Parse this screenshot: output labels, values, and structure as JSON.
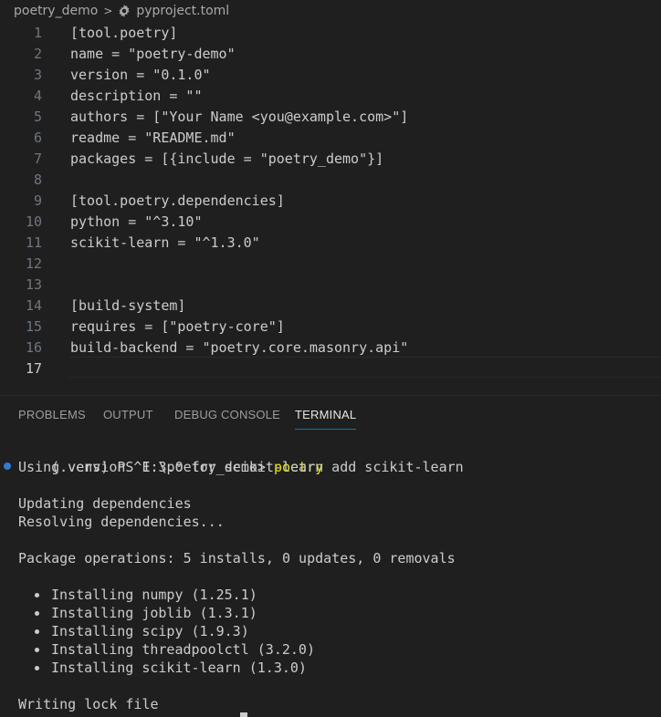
{
  "breadcrumb": {
    "folder": "poetry_demo",
    "separator": ">",
    "file_icon": "gear-icon",
    "file": "pyproject.toml"
  },
  "editor": {
    "lines": [
      {
        "number": "1",
        "text": "[tool.poetry]"
      },
      {
        "number": "2",
        "text": "name = \"poetry-demo\""
      },
      {
        "number": "3",
        "text": "version = \"0.1.0\""
      },
      {
        "number": "4",
        "text": "description = \"\""
      },
      {
        "number": "5",
        "text": "authors = [\"Your Name <you@example.com>\"]"
      },
      {
        "number": "6",
        "text": "readme = \"README.md\""
      },
      {
        "number": "7",
        "text": "packages = [{include = \"poetry_demo\"}]"
      },
      {
        "number": "8",
        "text": ""
      },
      {
        "number": "9",
        "text": "[tool.poetry.dependencies]"
      },
      {
        "number": "10",
        "text": "python = \"^3.10\""
      },
      {
        "number": "11",
        "text": "scikit-learn = \"^1.3.0\""
      },
      {
        "number": "12",
        "text": ""
      },
      {
        "number": "13",
        "text": ""
      },
      {
        "number": "14",
        "text": "[build-system]"
      },
      {
        "number": "15",
        "text": "requires = [\"poetry-core\"]"
      },
      {
        "number": "16",
        "text": "build-backend = \"poetry.core.masonry.api\""
      },
      {
        "number": "17",
        "text": ""
      }
    ],
    "active_line": "17"
  },
  "panel": {
    "tabs": [
      "PROBLEMS",
      "OUTPUT",
      "DEBUG CONSOLE",
      "TERMINAL"
    ],
    "active_tab": "TERMINAL"
  },
  "terminal": {
    "prompt": "(.venv) PS E:\\poetry_demo> ",
    "command_word": "poetry",
    "command_args": " add scikit-learn",
    "version_line": "Using version ^1.3.0 for scikit-learn",
    "updating": "Updating dependencies",
    "resolving": "Resolving dependencies...",
    "package_ops": "Package operations: 5 installs, 0 updates, 0 removals",
    "installs": [
      "Installing numpy (1.25.1)",
      "Installing joblib (1.3.1)",
      "Installing scipy (1.9.3)",
      "Installing threadpoolctl (3.2.0)",
      "Installing scikit-learn (1.3.0)"
    ],
    "writing": "Writing lock file"
  },
  "colors": {
    "background": "#1f1f1f",
    "command_highlight": "#e5e510",
    "active_tab_underline": "#0078d4",
    "status_dot": "#2e7dd1"
  }
}
